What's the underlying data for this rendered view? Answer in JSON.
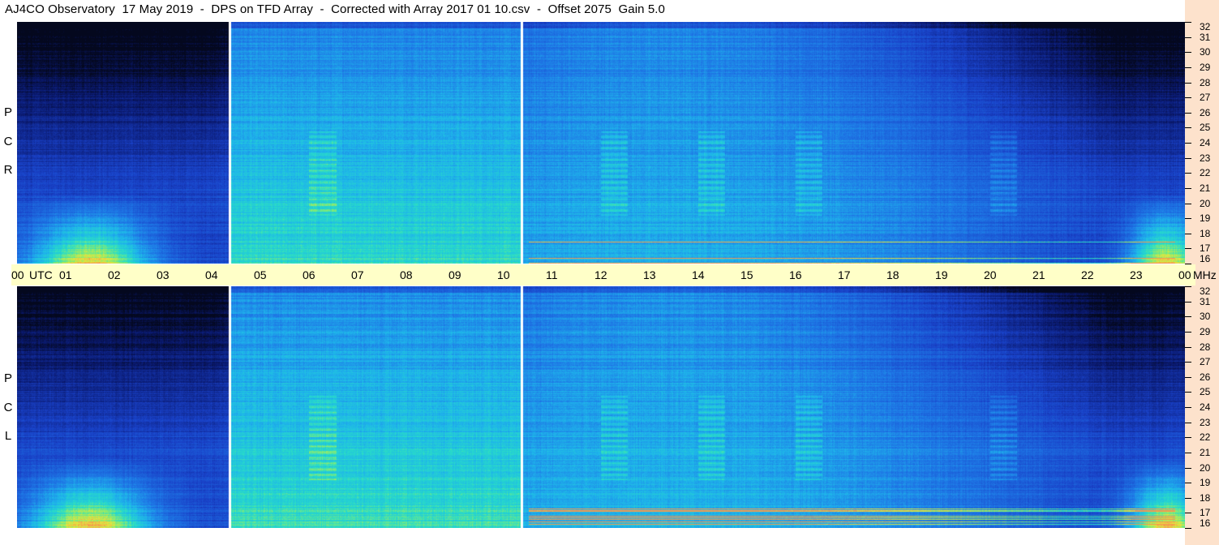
{
  "title": "AJ4CO Observatory  17 May 2019  -  DPS on TFD Array  -  Corrected with Array 2017 01 10.csv  -  Offset 2075  Gain 5.0",
  "panels": [
    {
      "id": "rcp",
      "letters": [
        "P",
        "C",
        "R"
      ]
    },
    {
      "id": "lcp",
      "letters": [
        "P",
        "C",
        "L"
      ]
    }
  ],
  "time_axis": {
    "labels": [
      "00",
      "UTC",
      "01",
      "02",
      "03",
      "04",
      "05",
      "06",
      "07",
      "08",
      "09",
      "10",
      "11",
      "12",
      "13",
      "14",
      "15",
      "16",
      "17",
      "18",
      "19",
      "20",
      "21",
      "22",
      "23",
      "00",
      "MHz"
    ]
  },
  "freq_axis": {
    "labels": [
      "32",
      "31",
      "30",
      "29",
      "28",
      "27",
      "26",
      "25",
      "24",
      "23",
      "22",
      "21",
      "20",
      "19",
      "18",
      "17",
      "16"
    ]
  },
  "colors": {
    "background_dark": "#050a2a",
    "background_mid": "#1a43c8",
    "background_light": "#1fb0e8",
    "hot": "#e8e040",
    "axis_band": "#ffffc8",
    "side_strip": "#fde2cc"
  },
  "chart_data": {
    "type": "heatmap",
    "title": "AJ4CO Observatory  17 May 2019  -  DPS on TFD Array  -  Corrected with Array 2017 01 10.csv  -  Offset 2075  Gain 5.0",
    "xlabel": "UTC",
    "ylabel": "MHz",
    "xlim": [
      0,
      24
    ],
    "ylim": [
      16,
      32
    ],
    "xticks": [
      "00",
      "01",
      "02",
      "03",
      "04",
      "05",
      "06",
      "07",
      "08",
      "09",
      "10",
      "11",
      "12",
      "13",
      "14",
      "15",
      "16",
      "17",
      "18",
      "19",
      "20",
      "21",
      "22",
      "23",
      "00"
    ],
    "yticks": [
      "16",
      "17",
      "18",
      "19",
      "20",
      "21",
      "22",
      "23",
      "24",
      "25",
      "26",
      "27",
      "28",
      "29",
      "30",
      "31",
      "32"
    ],
    "panels": [
      "RCP",
      "LCP"
    ],
    "data_gaps_utc": [
      4.35,
      10.35
    ]
  }
}
